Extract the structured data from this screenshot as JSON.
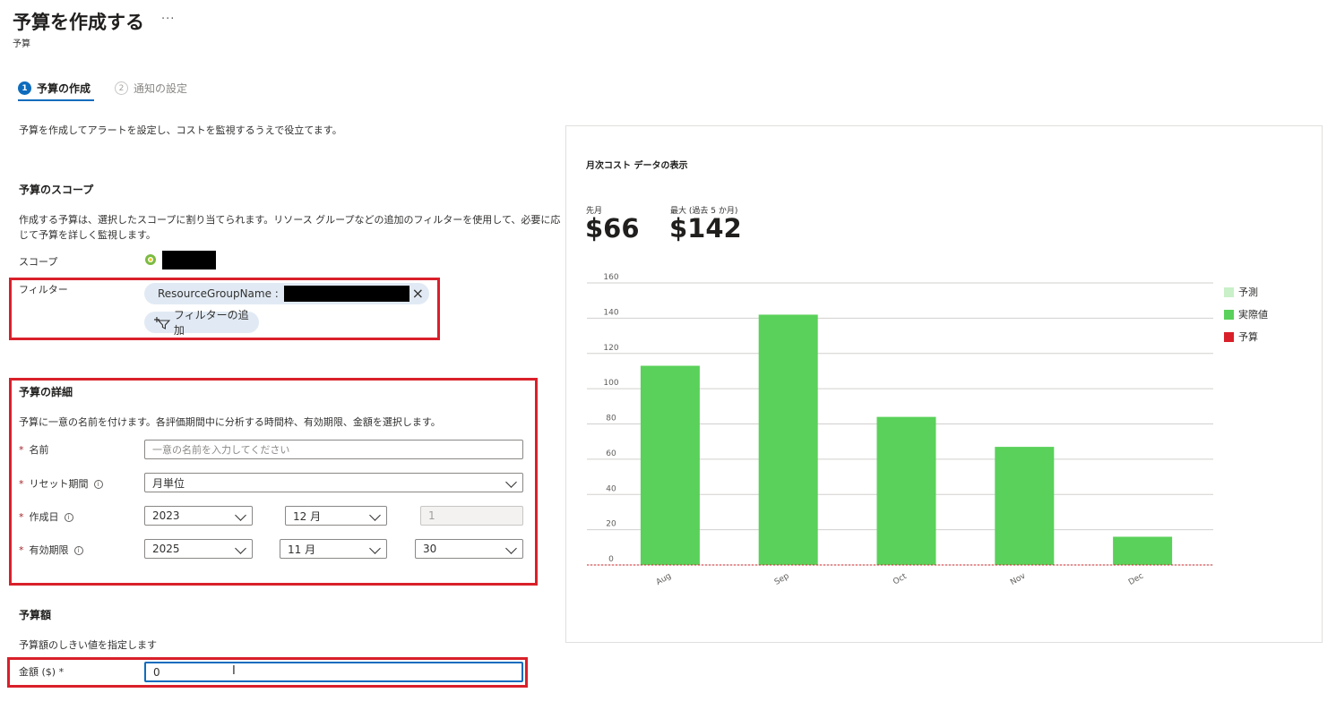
{
  "header": {
    "title": "予算を作成する",
    "more": "···",
    "breadcrumb": "予算"
  },
  "steps": [
    {
      "number": "1",
      "label": "予算の作成"
    },
    {
      "number": "2",
      "label": "通知の設定"
    }
  ],
  "intro": "予算を作成してアラートを設定し、コストを監視するうえで役立てます。",
  "scope_section": {
    "heading": "予算のスコープ",
    "description_line1": "作成する予算は、選択したスコープに割り当てられます。リソース グループなどの追加のフィルターを使用して、必要に応",
    "description_line2": "じて予算を詳しく監視します。",
    "scope_label": "スコープ",
    "filter_label": "フィルター",
    "filter_pill": "ResourceGroupName :",
    "add_filter": "フィルターの追加"
  },
  "details_section": {
    "heading": "予算の詳細",
    "description": "予算に一意の名前を付けます。各評価期間中に分析する時間枠、有効期限、金額を選択します。",
    "name_label": "名前",
    "name_placeholder": "一意の名前を入力してください",
    "reset_label": "リセット期間",
    "reset_value": "月単位",
    "created_label": "作成日",
    "created_year": "2023",
    "created_month": "12 月",
    "created_day": "1",
    "expiry_label": "有効期限",
    "expiry_year": "2025",
    "expiry_month": "11 月",
    "expiry_day": "30",
    "required_mark": "*",
    "info_mark": "i"
  },
  "amount_section": {
    "heading": "予算額",
    "description": "予算額のしきい値を指定します",
    "amount_label": "金額 ($) *",
    "amount_value": "0"
  },
  "chart_panel": {
    "title": "月次コスト データの表示",
    "last_month_label": "先月",
    "last_month_value": "$66",
    "max_label": "最大 (過去 5 か月)",
    "max_value": "$142"
  },
  "colors": {
    "actual": "#5ad15a",
    "forecast": "#c9f0c9",
    "budget": "#d9202a",
    "accent": "#0f6cbd",
    "highlight_box": "#d9202a"
  },
  "chart_data": {
    "type": "bar",
    "categories": [
      "Aug",
      "Sep",
      "Oct",
      "Nov",
      "Dec"
    ],
    "series": [
      {
        "name": "実際値",
        "values": [
          113,
          142,
          84,
          67,
          16
        ]
      }
    ],
    "budget_line": 0,
    "yticks": [
      0,
      20,
      40,
      60,
      80,
      100,
      120,
      140,
      160
    ],
    "ylim": [
      0,
      160
    ],
    "legend": [
      {
        "label": "予測",
        "color": "#c9f0c9"
      },
      {
        "label": "実際値",
        "color": "#5ad15a"
      },
      {
        "label": "予算",
        "color": "#d9202a"
      }
    ],
    "legend_position": "right",
    "grid": true
  }
}
